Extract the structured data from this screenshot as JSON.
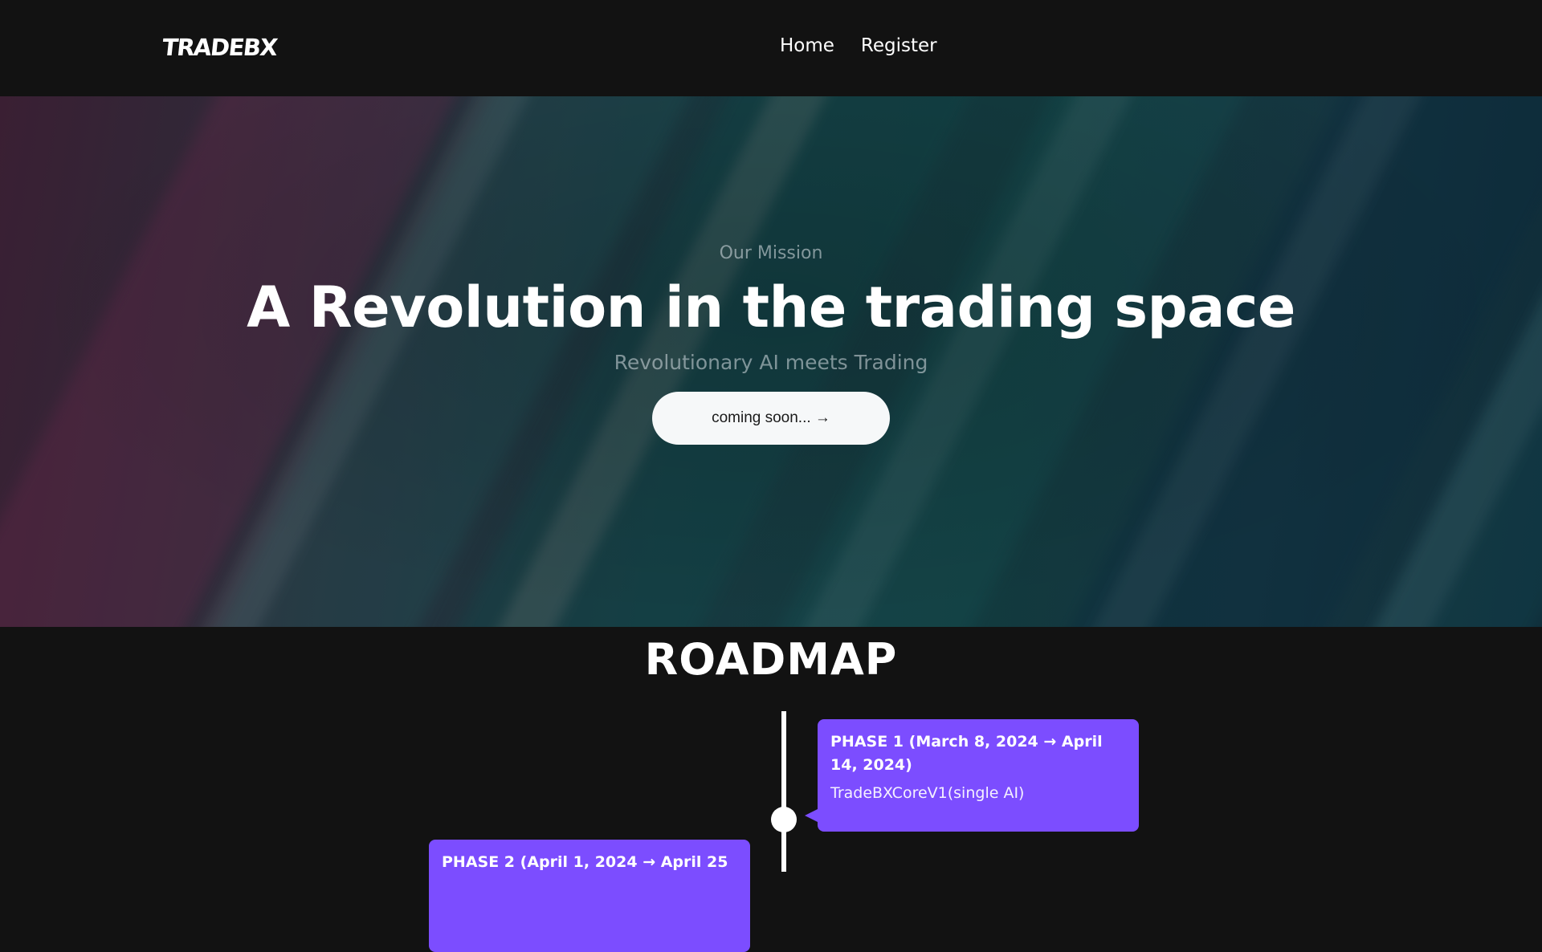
{
  "header": {
    "logo": "TRADEBX",
    "nav": [
      {
        "label": "Home"
      },
      {
        "label": "Register"
      }
    ]
  },
  "hero": {
    "eyebrow": "Our Mission",
    "title": "A Revolution in the trading space",
    "subtitle": "Revolutionary AI meets Trading",
    "cta_label": "coming soon... →"
  },
  "roadmap": {
    "title": "ROADMAP",
    "phases": [
      {
        "title": "PHASE 1 (March 8, 2024 → April 14, 2024)",
        "description": "TradeBXCoreV1(single AI)"
      },
      {
        "title": "PHASE 2 (April 1, 2024 → April 25",
        "description": ""
      }
    ]
  },
  "colors": {
    "background": "#121212",
    "card": "#7c4dff",
    "button": "#f6f8f9"
  }
}
